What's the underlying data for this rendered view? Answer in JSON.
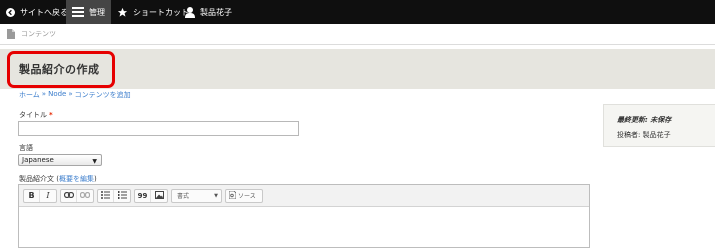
{
  "toolbar": {
    "back_label": "サイトへ戻る",
    "manage_label": "管理",
    "shortcuts_label": "ショートカット",
    "user_label": "製品花子"
  },
  "tray": {
    "content_label": "コンテンツ"
  },
  "page": {
    "title": "製品紹介の作成"
  },
  "breadcrumb": [
    {
      "label": "ホーム"
    },
    {
      "label": "Node"
    },
    {
      "label": "コンテンツを追加"
    }
  ],
  "breadcrumb_separator": "»",
  "form": {
    "title_label": "タイトル",
    "required_mark": "*",
    "language_label": "言語",
    "language_value": "Japanese",
    "body_label": "製品紹介文",
    "summary_link_open": "(",
    "summary_link": "概要を編集",
    "summary_link_close": ")"
  },
  "editor": {
    "bold": "B",
    "italic": "I",
    "blockquote": "99",
    "format_label": "書式",
    "source_label": "ソース"
  },
  "meta": {
    "last_updated": "最終更新: 未保存",
    "author": "投稿者: 製品花子"
  },
  "colors": {
    "toolbar_bg": "#0f0f0f",
    "active_tab_bg": "#454545",
    "title_region_bg": "#e6e5df",
    "highlight": "#e60000",
    "link": "#3b7dcc"
  }
}
